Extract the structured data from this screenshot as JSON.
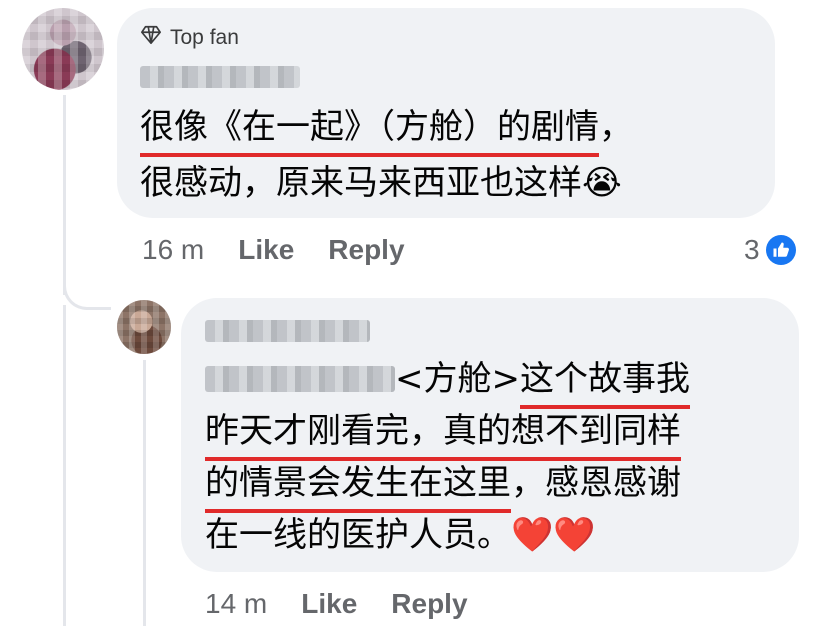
{
  "main_comment": {
    "badge_label": "Top fan",
    "text_underlined": "很像《在一起》（方舱）的剧情",
    "text_line1_rest": "，",
    "text_line2": "很感动，原来马来西亚也这样",
    "emoji": "😭",
    "time": "16 m",
    "like_label": "Like",
    "reply_label": "Reply",
    "reaction_count": "3"
  },
  "reply_comment": {
    "line1_prefix": " <方舱>",
    "line1_underlined": "这个故事我",
    "line2_underlined": "昨天才刚看完，真的想不到同样",
    "line3_underlined": "的情景会发生在这里",
    "line3_rest": "，感恩感谢",
    "line4": "在一线的医护人员。",
    "hearts": "❤️❤️",
    "time": "14 m",
    "like_label": "Like",
    "reply_label": "Reply"
  },
  "colors": {
    "bubble": "#f0f2f5",
    "underline": "#e02a2a",
    "meta": "#65676b",
    "like": "#1877f2"
  }
}
